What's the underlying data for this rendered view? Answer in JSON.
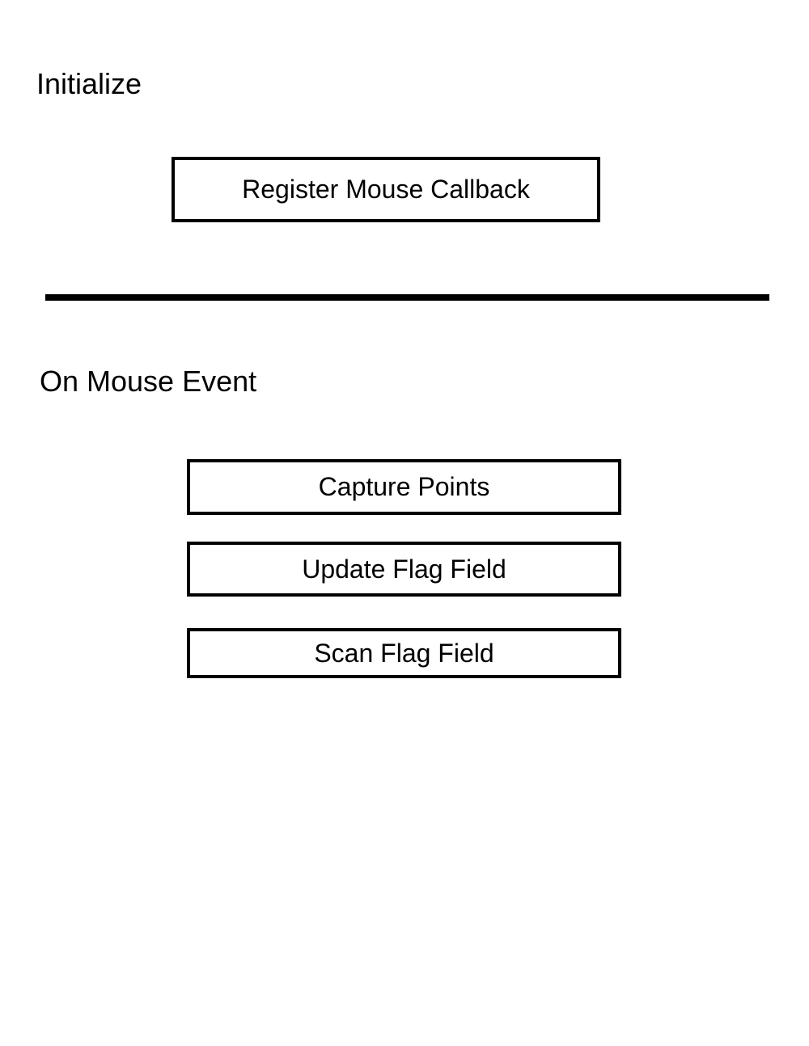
{
  "sections": {
    "initialize": {
      "label": "Initialize",
      "steps": [
        "Register Mouse Callback"
      ]
    },
    "on_mouse_event": {
      "label": "On Mouse Event",
      "steps": [
        "Capture Points",
        "Update Flag Field",
        "Scan Flag Field"
      ]
    }
  },
  "colors": {
    "stroke": "#000000",
    "background": "#ffffff",
    "text": "#000000"
  }
}
